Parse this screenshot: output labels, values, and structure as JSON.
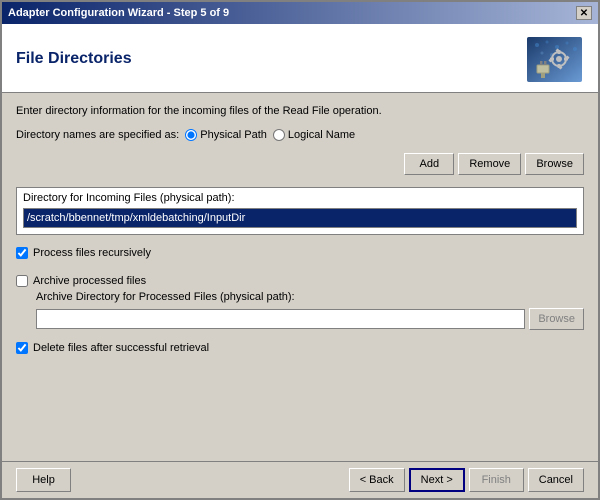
{
  "window": {
    "title": "Adapter Configuration Wizard - Step 5 of 9",
    "close_label": "✕"
  },
  "header": {
    "title": "File Directories"
  },
  "content": {
    "info_text": "Enter directory information for the incoming files of the Read File operation.",
    "directory_names_label": "Directory names are specified as:",
    "radio_physical": "Physical Path",
    "radio_logical": "Logical Name",
    "btn_add": "Add",
    "btn_remove": "Remove",
    "btn_browse": "Browse",
    "incoming_group_label": "Directory for Incoming Files (physical path):",
    "incoming_path_value": "/scratch/bbennet/tmp/xmldebatching/InputDir",
    "checkbox_recursive_label": "Process files recursively",
    "checkbox_archive_label": "Archive processed files",
    "archive_path_label": "Archive Directory for Processed Files (physical path):",
    "archive_path_value": "",
    "btn_browse_archive": "Browse",
    "checkbox_delete_label": "Delete files after successful retrieval"
  },
  "footer": {
    "btn_help": "Help",
    "btn_back": "< Back",
    "btn_next": "Next >",
    "btn_finish": "Finish",
    "btn_cancel": "Cancel"
  },
  "state": {
    "radio_selected": "physical",
    "checkbox_recursive": true,
    "checkbox_archive": false,
    "checkbox_delete": true
  }
}
